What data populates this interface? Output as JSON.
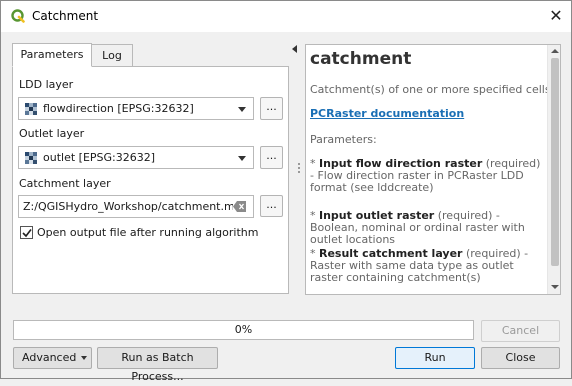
{
  "window": {
    "title": "Catchment",
    "close_glyph": "✕",
    "icon": "qgis-logo-icon"
  },
  "tabs": [
    {
      "label": "Parameters",
      "active": true
    },
    {
      "label": "Log",
      "active": false
    }
  ],
  "params": {
    "ldd": {
      "label": "LDD layer",
      "value": "flowdirection [EPSG:32632]",
      "icon": "raster-layer-icon"
    },
    "outlet": {
      "label": "Outlet layer",
      "value": "outlet [EPSG:32632]",
      "icon": "raster-layer-icon"
    },
    "catchment": {
      "label": "Catchment layer",
      "value": "Z:/QGISHydro_Workshop/catchment.map"
    },
    "browse_label": "...",
    "open_output": {
      "label": "Open output file after running algorithm",
      "checked": true
    }
  },
  "help": {
    "title": "catchment",
    "description": "Catchment(s) of one or more specified cells",
    "link": "PCRaster documentation",
    "params_heading": "Parameters:",
    "items": [
      {
        "bullet": "* ",
        "name": "Input flow direction raster",
        "required": " (required)",
        "desc": " - Flow direction raster in PCRaster LDD format (see lddcreate)"
      },
      {
        "bullet": "* ",
        "name": "Input outlet raster",
        "required": " (required)",
        "desc": " - Boolean, nominal or ordinal raster with outlet locations"
      },
      {
        "bullet": "* ",
        "name": "Result catchment layer",
        "required": " (required)",
        "desc": " - Raster with same data type as outlet raster containing catchment(s)"
      }
    ]
  },
  "progress": {
    "text": "0%",
    "value": 0
  },
  "buttons": {
    "cancel": "Cancel",
    "advanced": "Advanced",
    "batch": "Run as Batch Process...",
    "run": "Run",
    "close": "Close"
  },
  "colors": {
    "link": "#1a6fb5",
    "qgis_green": "#589632",
    "qgis_yellow": "#f0c021",
    "primary_border": "#0078d7"
  }
}
